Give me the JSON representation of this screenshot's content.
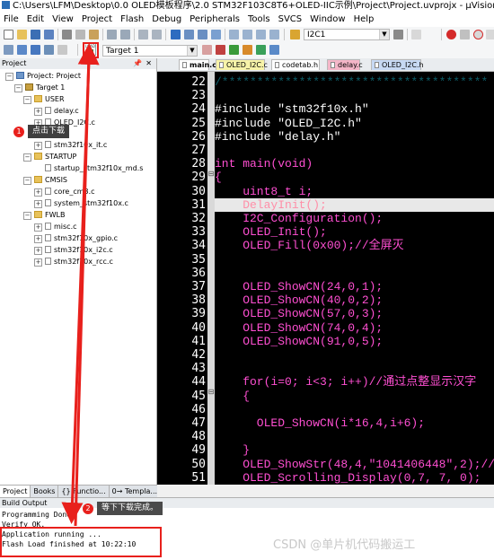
{
  "window": {
    "title": "C:\\Users\\LFM\\Desktop\\0.0 OLED模板程序\\2.0 STM32F103C8T6+OLED-IIC示例\\Project\\Project.uvprojx - µVision"
  },
  "menu": [
    "File",
    "Edit",
    "View",
    "Project",
    "Flash",
    "Debug",
    "Peripherals",
    "Tools",
    "SVCS",
    "Window",
    "Help"
  ],
  "toolbar": {
    "find_combo": "I2C1",
    "target_combo": "Target 1",
    "download_label": "LOAD"
  },
  "project_panel": {
    "title": "Project",
    "tree": [
      {
        "label": "Project: Project",
        "icon": "project-icon"
      },
      {
        "label": "Target 1",
        "icon": "target-icon"
      },
      {
        "label": "USER",
        "icon": "folder-icon"
      },
      {
        "label": "delay.c",
        "icon": "file-icon"
      },
      {
        "label": "OLED_I2C.c",
        "icon": "file-icon"
      },
      {
        "label": "stm32f10x_it.c",
        "icon": "file-icon"
      },
      {
        "label": "STARTUP",
        "icon": "folder-icon"
      },
      {
        "label": "startup_stm32f10x_md.s",
        "icon": "file-icon"
      },
      {
        "label": "CMSIS",
        "icon": "folder-icon"
      },
      {
        "label": "core_cm3.c",
        "icon": "file-icon"
      },
      {
        "label": "system_stm32f10x.c",
        "icon": "file-icon"
      },
      {
        "label": "FWLB",
        "icon": "folder-icon"
      },
      {
        "label": "misc.c",
        "icon": "file-icon"
      },
      {
        "label": "stm32f10x_gpio.c",
        "icon": "file-icon"
      },
      {
        "label": "stm32f10x_i2c.c",
        "icon": "file-icon"
      },
      {
        "label": "stm32f10x_rcc.c",
        "icon": "file-icon"
      }
    ],
    "tabs": [
      "Project",
      "Books",
      "{} Functio...",
      "0→ Templa..."
    ]
  },
  "file_tabs": [
    {
      "label": "main.c",
      "color": "#ffffff",
      "active": true
    },
    {
      "label": "OLED_I2C.c",
      "color": "#f7f3a8"
    },
    {
      "label": "codetab.h",
      "color": "#ffffff"
    },
    {
      "label": "delay.c",
      "color": "#f4b6c8"
    },
    {
      "label": "OLED_I2C.h",
      "color": "#c7d9f3"
    }
  ],
  "code": {
    "first_line": 22,
    "lines": [
      {
        "n": "22",
        "text": "/**************************************",
        "color": "#0b5f6b"
      },
      {
        "n": "23",
        "text": "",
        "color": "#ffffff"
      },
      {
        "n": "24",
        "text": "#include \"stm32f10x.h\"",
        "color": "#ffffff"
      },
      {
        "n": "25",
        "text": "#include \"OLED_I2C.h\"",
        "color": "#ffffff"
      },
      {
        "n": "26",
        "text": "#include \"delay.h\"",
        "color": "#ffffff"
      },
      {
        "n": "27",
        "text": "",
        "color": "#ffffff"
      },
      {
        "n": "28",
        "text": "int main(void)",
        "color": "#ff4fd2"
      },
      {
        "n": "29",
        "text": "{",
        "color": "#ff4fd2"
      },
      {
        "n": "30",
        "text": "    uint8_t i;",
        "color": "#ff4fd2"
      },
      {
        "n": "31",
        "text": "    DelayInit();",
        "color": "#ff8fa8",
        "highlight": true
      },
      {
        "n": "32",
        "text": "    I2C_Configuration();",
        "color": "#ff4fd2"
      },
      {
        "n": "33",
        "text": "    OLED_Init();",
        "color": "#ff4fd2"
      },
      {
        "n": "34",
        "text": "    OLED_Fill(0x00);//全屏灭",
        "color": "#ff4fd2"
      },
      {
        "n": "35",
        "text": "",
        "color": "#ffffff"
      },
      {
        "n": "36",
        "text": "",
        "color": "#ffffff"
      },
      {
        "n": "37",
        "text": "    OLED_ShowCN(24,0,1);",
        "color": "#ff4fd2"
      },
      {
        "n": "38",
        "text": "    OLED_ShowCN(40,0,2);",
        "color": "#ff4fd2"
      },
      {
        "n": "39",
        "text": "    OLED_ShowCN(57,0,3);",
        "color": "#ff4fd2"
      },
      {
        "n": "40",
        "text": "    OLED_ShowCN(74,0,4);",
        "color": "#ff4fd2"
      },
      {
        "n": "41",
        "text": "    OLED_ShowCN(91,0,5);",
        "color": "#ff4fd2"
      },
      {
        "n": "42",
        "text": "",
        "color": "#ffffff"
      },
      {
        "n": "43",
        "text": "",
        "color": "#ffffff"
      },
      {
        "n": "44",
        "text": "    for(i=0; i<3; i++)//通过点整显示汉字",
        "color": "#ff4fd2"
      },
      {
        "n": "45",
        "text": "    {",
        "color": "#ff4fd2"
      },
      {
        "n": "46",
        "text": "",
        "color": "#ffffff"
      },
      {
        "n": "47",
        "text": "      OLED_ShowCN(i*16,4,i+6);",
        "color": "#ff4fd2"
      },
      {
        "n": "48",
        "text": "",
        "color": "#ffffff"
      },
      {
        "n": "49",
        "text": "    }",
        "color": "#ff4fd2"
      },
      {
        "n": "50",
        "text": "    OLED_ShowStr(48,4,\"1041406448\",2);//",
        "color": "#ff4fd2"
      },
      {
        "n": "51",
        "text": "    OLED_Scrolling_Display(0,7, 7, 0);",
        "color": "#ff4fd2"
      }
    ]
  },
  "build_output": {
    "title": "Build Output",
    "lines": [
      "Programming Done.",
      "Verify OK.",
      "Application running ...",
      "Flash Load finished at 10:22:10"
    ]
  },
  "annotations": [
    {
      "num": "1",
      "text": "点击下载"
    },
    {
      "num": "2",
      "text": "等下下载完成。"
    }
  ],
  "watermark": "CSDN @单片机代码搬运工"
}
